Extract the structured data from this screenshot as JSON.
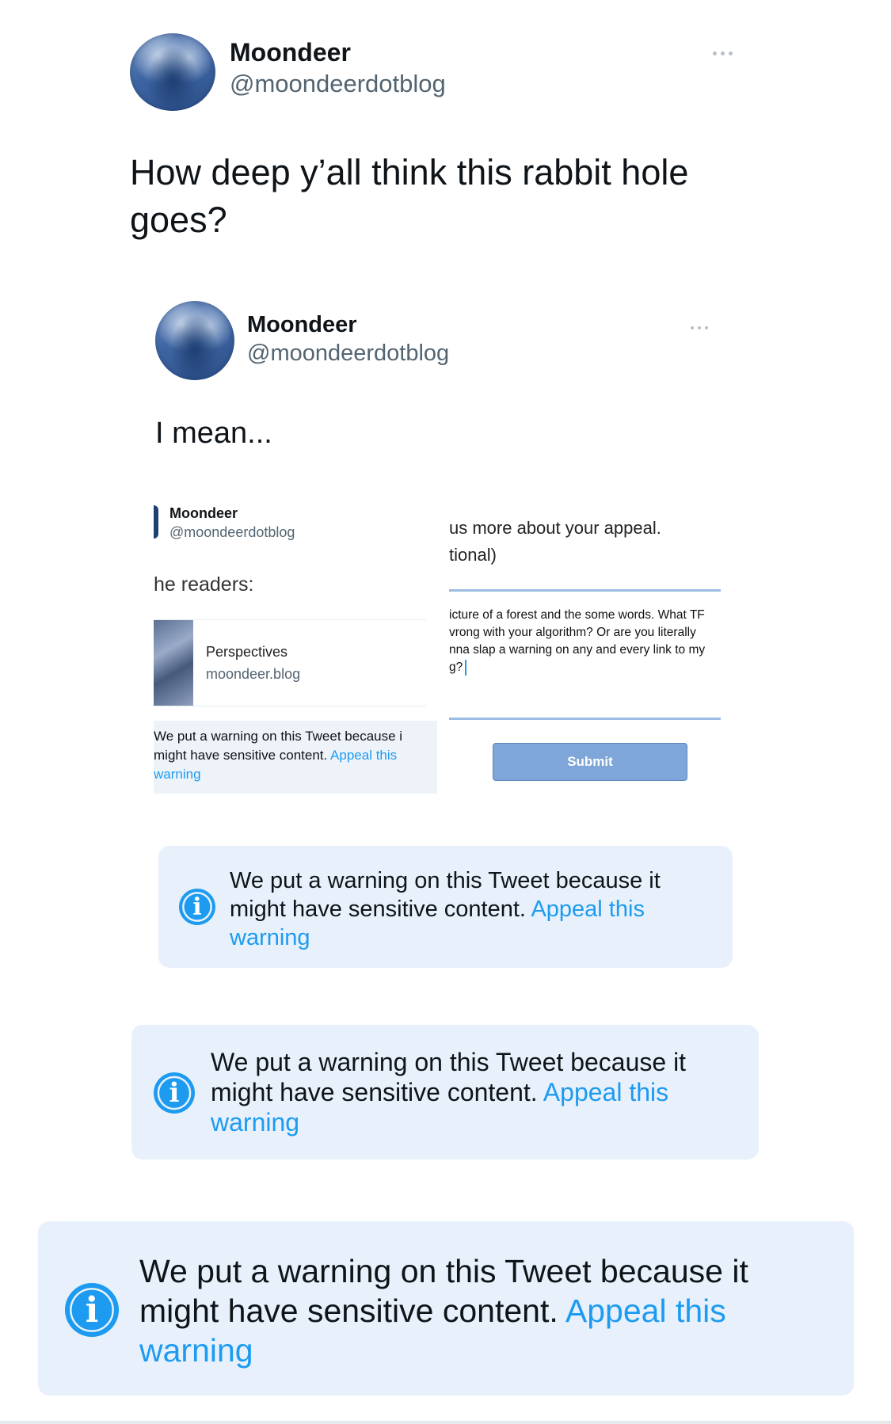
{
  "tweet": {
    "author_name": "Moondeer",
    "author_handle": "@moondeerdotblog",
    "text": "How deep y’all think this rabbit hole goes?"
  },
  "quoted": {
    "author_name": "Moondeer",
    "author_handle": "@moondeerdotblog",
    "text": "I mean..."
  },
  "screenshot": {
    "left": {
      "author_name": "Moondeer",
      "author_handle": "@moondeerdotblog",
      "readers_text": "he readers:",
      "card_title": "Perspectives",
      "card_domain": "moondeer.blog",
      "warning_text": "We put a warning on this Tweet because i might have sensitive content.",
      "warning_link": "Appeal this warning"
    },
    "right": {
      "prompt_line1": "us more about your appeal.",
      "prompt_line2": "tional)",
      "appeal_lines": [
        "icture of a forest and the some words. What TF",
        "vrong with your algorithm? Or are you literally",
        "nna slap a warning on any and every link to my",
        "g?"
      ],
      "submit_label": "Submit"
    }
  },
  "warnings": [
    {
      "text": "We put a warning on this Tweet because it might have sensitive content.",
      "link": "Appeal this warning"
    },
    {
      "text": "We put a warning on this Tweet because it might have sensitive content.",
      "link": "Appeal this warning"
    },
    {
      "text": "We put a warning on this Tweet because it might have sensitive content.",
      "link": "Appeal this warning"
    }
  ],
  "icons": [
    "more-dots-icon",
    "info-icon",
    "avatar"
  ],
  "colors": {
    "accent": "#1d9bf0",
    "banner_bg": "#e8f1fb",
    "text": "#0f1419",
    "muted": "#536471"
  }
}
